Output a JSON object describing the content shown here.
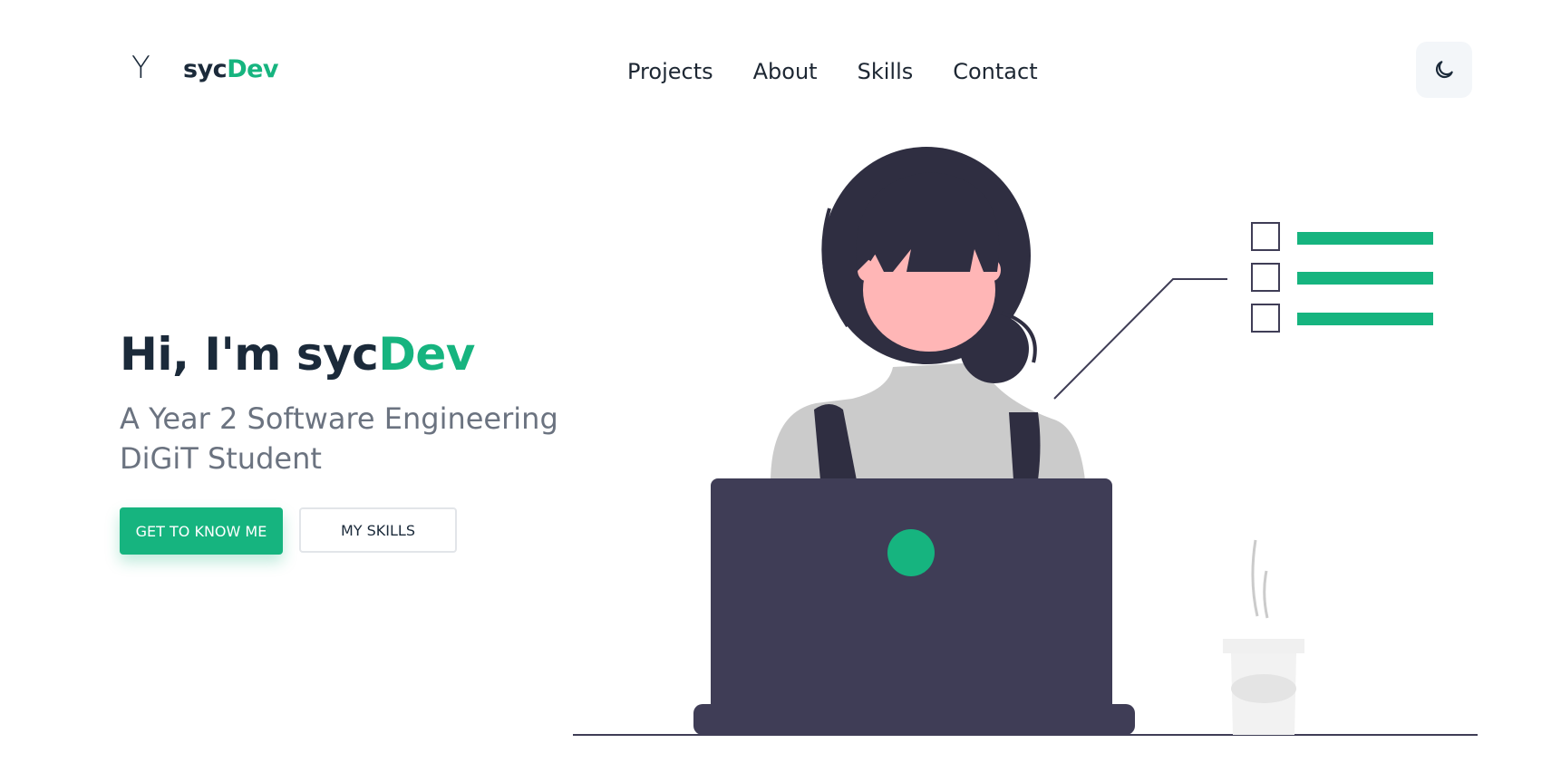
{
  "header": {
    "logo_glyph": "Y",
    "brand_part1": "syc",
    "brand_part2": "Dev",
    "nav": [
      "Projects",
      "About",
      "Skills",
      "Contact"
    ],
    "theme_toggle_icon": "moon-icon"
  },
  "hero": {
    "greeting": "Hi, I'm ",
    "name_part1": "syc",
    "name_part2": "Dev",
    "subtitle": "A Year 2 Software Engineering DiGiT Student",
    "primary_button": "GET TO KNOW ME",
    "secondary_button": "MY SKILLS"
  },
  "colors": {
    "accent": "#16b47f",
    "text_dark": "#1b2a3a",
    "text_muted": "#6b7380",
    "laptop": "#3f3d56",
    "hair": "#2f2e41",
    "skin": "#ffb6b6",
    "shirt": "#cbcbcb"
  }
}
